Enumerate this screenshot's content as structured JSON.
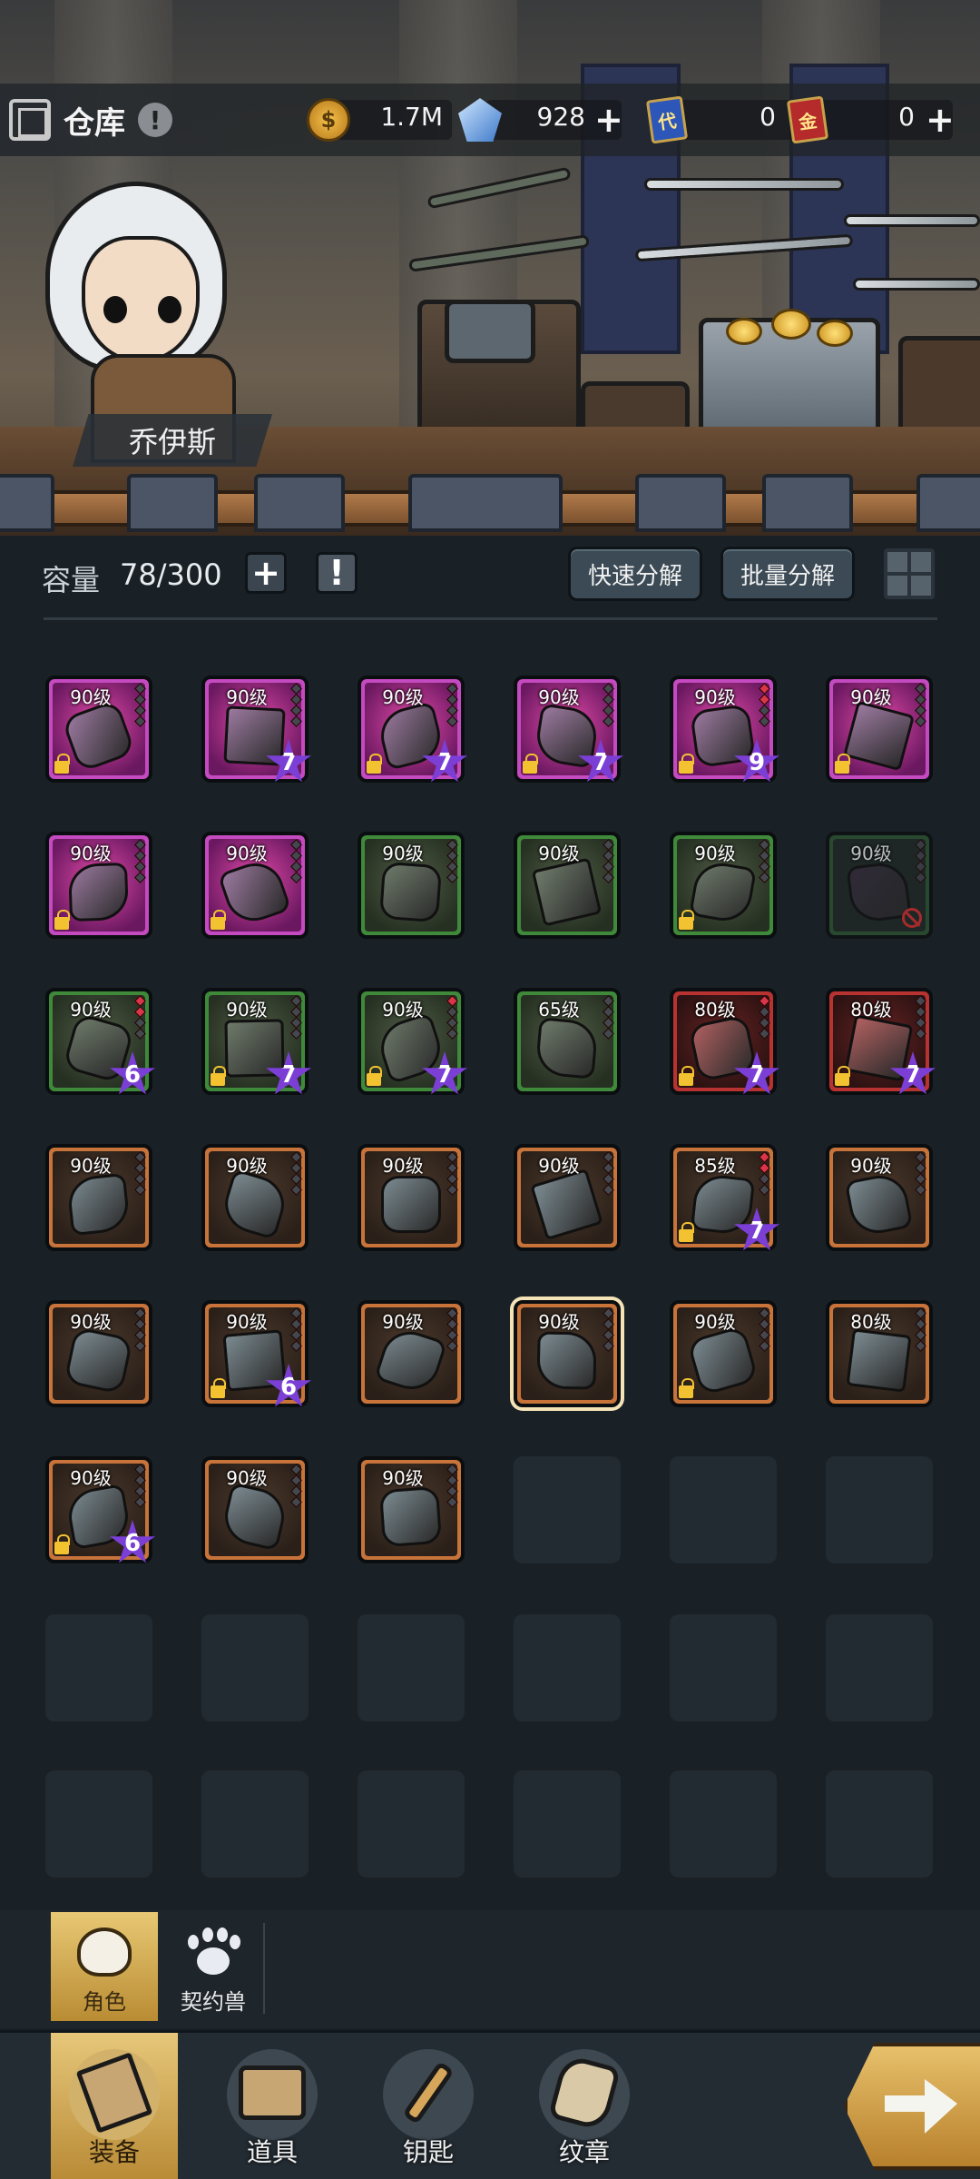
{
  "header": {
    "title": "仓库",
    "alert_icon": "!",
    "resources": [
      {
        "name": "gold-coin",
        "icon": "coin-icon",
        "value": "1.7M",
        "plus": false
      },
      {
        "name": "crystal",
        "icon": "crystal-icon",
        "value": "928",
        "plus": true
      },
      {
        "name": "blue-card",
        "icon": "card-icon",
        "icon_text": "代",
        "value": "0",
        "plus": false
      },
      {
        "name": "red-card",
        "icon": "card-icon",
        "icon_text": "金",
        "value": "0",
        "plus": true
      }
    ],
    "plus_symbol": "+"
  },
  "character": {
    "name": "乔伊斯"
  },
  "capacity": {
    "label": "容量",
    "value": "78/300",
    "add_symbol": "+",
    "quick_decompose": "快速分解",
    "batch_decompose": "批量分解"
  },
  "inventory": {
    "level_suffix": "级",
    "items": [
      {
        "level": "90级",
        "quality": "purple",
        "locked": true,
        "stars": null,
        "pips": [
          false,
          false,
          false,
          false
        ]
      },
      {
        "level": "90级",
        "quality": "purple",
        "locked": false,
        "stars": "7",
        "pips": [
          false,
          false,
          false,
          false
        ]
      },
      {
        "level": "90级",
        "quality": "purple",
        "locked": true,
        "stars": "7",
        "pips": [
          false,
          false,
          false,
          false
        ]
      },
      {
        "level": "90级",
        "quality": "purple",
        "locked": true,
        "stars": "7",
        "pips": [
          false,
          false,
          false,
          false
        ]
      },
      {
        "level": "90级",
        "quality": "purple",
        "locked": true,
        "stars": "9",
        "pips": [
          true,
          true,
          false,
          false
        ]
      },
      {
        "level": "90级",
        "quality": "purple",
        "locked": true,
        "stars": null,
        "pips": [
          false,
          false,
          false,
          false
        ]
      },
      {
        "level": "90级",
        "quality": "purple",
        "locked": true,
        "stars": null,
        "pips": [
          false,
          false,
          false,
          false
        ]
      },
      {
        "level": "90级",
        "quality": "purple",
        "locked": true,
        "stars": null,
        "pips": [
          false,
          false,
          false,
          false
        ]
      },
      {
        "level": "90级",
        "quality": "green",
        "locked": false,
        "stars": null,
        "pips": [
          false,
          false,
          false,
          false
        ]
      },
      {
        "level": "90级",
        "quality": "green",
        "locked": false,
        "stars": null,
        "pips": [
          false,
          false,
          false,
          false
        ]
      },
      {
        "level": "90级",
        "quality": "green",
        "locked": true,
        "stars": null,
        "pips": [
          false,
          false,
          false,
          false
        ]
      },
      {
        "level": "90级",
        "quality": "dim",
        "locked": false,
        "stars": null,
        "banned": true,
        "pips": [
          false,
          false,
          false,
          false
        ]
      },
      {
        "level": "90级",
        "quality": "green",
        "locked": false,
        "stars": "6",
        "pips": [
          true,
          true,
          false,
          false
        ]
      },
      {
        "level": "90级",
        "quality": "green",
        "locked": true,
        "stars": "7",
        "pips": [
          false,
          false,
          false,
          false
        ]
      },
      {
        "level": "90级",
        "quality": "green",
        "locked": true,
        "stars": "7",
        "pips": [
          true,
          false,
          false,
          false
        ]
      },
      {
        "level": "65级",
        "quality": "green",
        "locked": false,
        "stars": null,
        "pips": [
          false,
          false,
          false,
          false
        ]
      },
      {
        "level": "80级",
        "quality": "red",
        "locked": true,
        "stars": "7",
        "pips": [
          true,
          false,
          false,
          false
        ]
      },
      {
        "level": "80级",
        "quality": "red",
        "locked": true,
        "stars": "7",
        "pips": [
          false,
          false,
          false,
          false
        ]
      },
      {
        "level": "90级",
        "quality": "orange",
        "locked": false,
        "stars": null,
        "pips": [
          false,
          false,
          false,
          false
        ]
      },
      {
        "level": "90级",
        "quality": "orange",
        "locked": false,
        "stars": null,
        "pips": [
          false,
          false,
          false,
          false
        ]
      },
      {
        "level": "90级",
        "quality": "orange",
        "locked": false,
        "stars": null,
        "pips": [
          false,
          false,
          false,
          false
        ]
      },
      {
        "level": "90级",
        "quality": "orange",
        "locked": false,
        "stars": null,
        "pips": [
          false,
          false,
          false,
          false
        ]
      },
      {
        "level": "85级",
        "quality": "orange",
        "locked": true,
        "stars": "7",
        "pips": [
          true,
          true,
          false,
          false
        ]
      },
      {
        "level": "90级",
        "quality": "orange",
        "locked": false,
        "stars": null,
        "pips": [
          false,
          false,
          false,
          false
        ]
      },
      {
        "level": "90级",
        "quality": "orange",
        "locked": false,
        "stars": null,
        "pips": [
          false,
          false,
          false,
          false
        ]
      },
      {
        "level": "90级",
        "quality": "orange",
        "locked": true,
        "stars": "6",
        "pips": [
          false,
          false,
          false,
          false
        ]
      },
      {
        "level": "90级",
        "quality": "orange",
        "locked": false,
        "stars": null,
        "pips": [
          false,
          false,
          false,
          false
        ]
      },
      {
        "level": "90级",
        "quality": "orange",
        "locked": false,
        "stars": null,
        "selected": true,
        "pips": [
          false,
          false,
          false,
          false
        ]
      },
      {
        "level": "90级",
        "quality": "orange",
        "locked": true,
        "stars": null,
        "pips": [
          false,
          false,
          false,
          false
        ]
      },
      {
        "level": "80级",
        "quality": "orange",
        "locked": false,
        "stars": null,
        "pips": [
          false,
          false,
          false,
          false
        ]
      },
      {
        "level": "90级",
        "quality": "orange",
        "locked": true,
        "stars": "6",
        "pips": [
          false,
          false,
          false,
          false
        ]
      },
      {
        "level": "90级",
        "quality": "orange",
        "locked": false,
        "stars": null,
        "pips": [
          false,
          false,
          false,
          false
        ]
      },
      {
        "level": "90级",
        "quality": "orange",
        "locked": false,
        "stars": null,
        "pips": [
          false,
          false,
          false,
          false
        ]
      }
    ],
    "empty_slot_count": 15
  },
  "sub_tabs": [
    {
      "label": "角色",
      "icon": "character-icon",
      "active": true
    },
    {
      "label": "契约兽",
      "icon": "paw-icon",
      "active": false
    }
  ],
  "nav": [
    {
      "label": "装备",
      "icon": "equipment-icon",
      "active": true
    },
    {
      "label": "道具",
      "icon": "chest-icon",
      "active": false
    },
    {
      "label": "钥匙",
      "icon": "key-icon",
      "active": false
    },
    {
      "label": "纹章",
      "icon": "emblem-icon",
      "active": false
    }
  ],
  "colors": {
    "background": "#1a2126",
    "quality_purple": "#c44ac0",
    "quality_green": "#3f8a3a",
    "quality_orange": "#c7733a",
    "quality_red": "#b83232",
    "star_purple": "#7b3fd6",
    "accent_gold": "#e0bf6e"
  }
}
